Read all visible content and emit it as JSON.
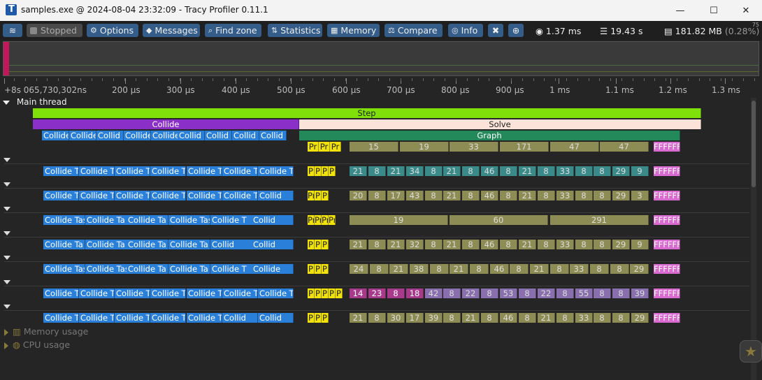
{
  "window": {
    "title": "samples.exe @ 2024-08-04 23:32:09 - Tracy Profiler 0.11.1",
    "minimize": "—",
    "maximize": "☐",
    "close": "✕"
  },
  "toolbar": {
    "connection_icon": "wifi-icon",
    "stopped_label": "Stopped",
    "options_label": "Options",
    "messages_label": "Messages",
    "find_zone_label": "Find zone",
    "statistics_label": "Statistics",
    "memory_label": "Memory",
    "compare_label": "Compare",
    "info_label": "Info",
    "frame_time": "1.37 ms",
    "total_time": "19.43 s",
    "memory_usage": "181.82 MB",
    "memory_pct": "(0.28%)",
    "fps_value": "75"
  },
  "ruler": {
    "labels": [
      "+8s 065,730,302ns",
      "200 µs",
      "300 µs",
      "400 µs",
      "500 µs",
      "600 µs",
      "700 µs",
      "800 µs",
      "900 µs",
      "1 ms",
      "1.1 ms",
      "1.2 ms",
      "1.3 ms"
    ]
  },
  "thread": {
    "name": "Main thread",
    "step": "Step",
    "collide": "Collide",
    "solve": "Solve",
    "graph": "Graph"
  },
  "sections": {
    "memory_usage": "Memory usage",
    "cpu_usage": "CPU usage"
  },
  "rows": [
    {
      "collide_zones": [
        "Collide Ta",
        "Collide T",
        "Collid",
        "Collide",
        "Collide",
        "Collid",
        "Collid",
        "Collid",
        "Collid"
      ],
      "pr": [
        "Pr",
        "Pr",
        "Pr"
      ],
      "nums": [
        "15",
        "19",
        "33",
        "171",
        "47",
        "47"
      ],
      "ff": "FFFFFF"
    },
    {
      "collide_zones": [
        "Collide Ta",
        "Collide T",
        "Collide T",
        "Collide T",
        "Collide T",
        "Collide T",
        "Collide T"
      ],
      "pr": [
        "P",
        "P",
        "P",
        "P"
      ],
      "nums": [
        "21",
        "8",
        "21",
        "34",
        "8",
        "21",
        "8",
        "46",
        "8",
        "21",
        "8",
        "33",
        "8",
        "8",
        "29",
        "9"
      ],
      "ff": "FFFFFF"
    },
    {
      "collide_zones": [
        "Collide Tas",
        "Collide Ta",
        "Collide Ta",
        "Collide Ta",
        "Collide Ta",
        "Collide T",
        "Collid"
      ],
      "pr": [
        "Pr",
        "P",
        "P"
      ],
      "nums": [
        "20",
        "8",
        "17",
        "43",
        "8",
        "21",
        "8",
        "46",
        "8",
        "21",
        "8",
        "33",
        "8",
        "8",
        "29",
        "3"
      ],
      "ff": "FFFFFF"
    },
    {
      "collide_zones": [
        "Collide Tas",
        "Collide Ta",
        "Collide Ta",
        "Collide Tas",
        "Collide T",
        "Collid"
      ],
      "pr": [
        "Pr",
        "Pr",
        "Pr",
        "Pr"
      ],
      "nums": [
        "19",
        "60",
        "291"
      ],
      "ff": "FFFFFF"
    },
    {
      "collide_zones": [
        "Collide Ta",
        "Collide Ta",
        "Collide Ta",
        "Collide Ta",
        "Collid",
        "Collid"
      ],
      "pr": [
        "P",
        "P",
        "P"
      ],
      "nums": [
        "21",
        "8",
        "21",
        "32",
        "8",
        "21",
        "8",
        "46",
        "8",
        "21",
        "8",
        "33",
        "8",
        "8",
        "29",
        "9"
      ],
      "ff": "FFFFFF"
    },
    {
      "collide_zones": [
        "Collide Tas",
        "Collide Tas",
        "Collide Ta",
        "Collide Ta",
        "Collide T",
        "Collide"
      ],
      "pr": [
        "P",
        "P",
        "P"
      ],
      "nums": [
        "24",
        "8",
        "21",
        "38",
        "8",
        "21",
        "8",
        "46",
        "8",
        "21",
        "8",
        "33",
        "8",
        "8",
        "29"
      ],
      "ff": "FFFFFF"
    },
    {
      "collide_zones": [
        "Collide Ta",
        "Collide T",
        "Collide Ta",
        "Collide T",
        "Collide T",
        "Collide T",
        "Collide T"
      ],
      "pr": [
        "P",
        "P",
        "P",
        "P",
        "P"
      ],
      "nums": [
        "14",
        "23",
        "8",
        "18",
        "42",
        "8",
        "22",
        "8",
        "53",
        "8",
        "22",
        "8",
        "55",
        "8",
        "8",
        "39"
      ],
      "ff": "FFFFFF"
    },
    {
      "collide_zones": [
        "Collide Tas",
        "Collide Ta",
        "Collide Ta",
        "Collide Ta",
        "Collide T",
        "Collid",
        "Collid"
      ],
      "pr": [
        "P",
        "P",
        "P"
      ],
      "nums": [
        "21",
        "8",
        "30",
        "17",
        "39",
        "8",
        "21",
        "8",
        "46",
        "8",
        "21",
        "8",
        "33",
        "8",
        "8",
        "29"
      ],
      "ff": "FFFFFF"
    }
  ]
}
